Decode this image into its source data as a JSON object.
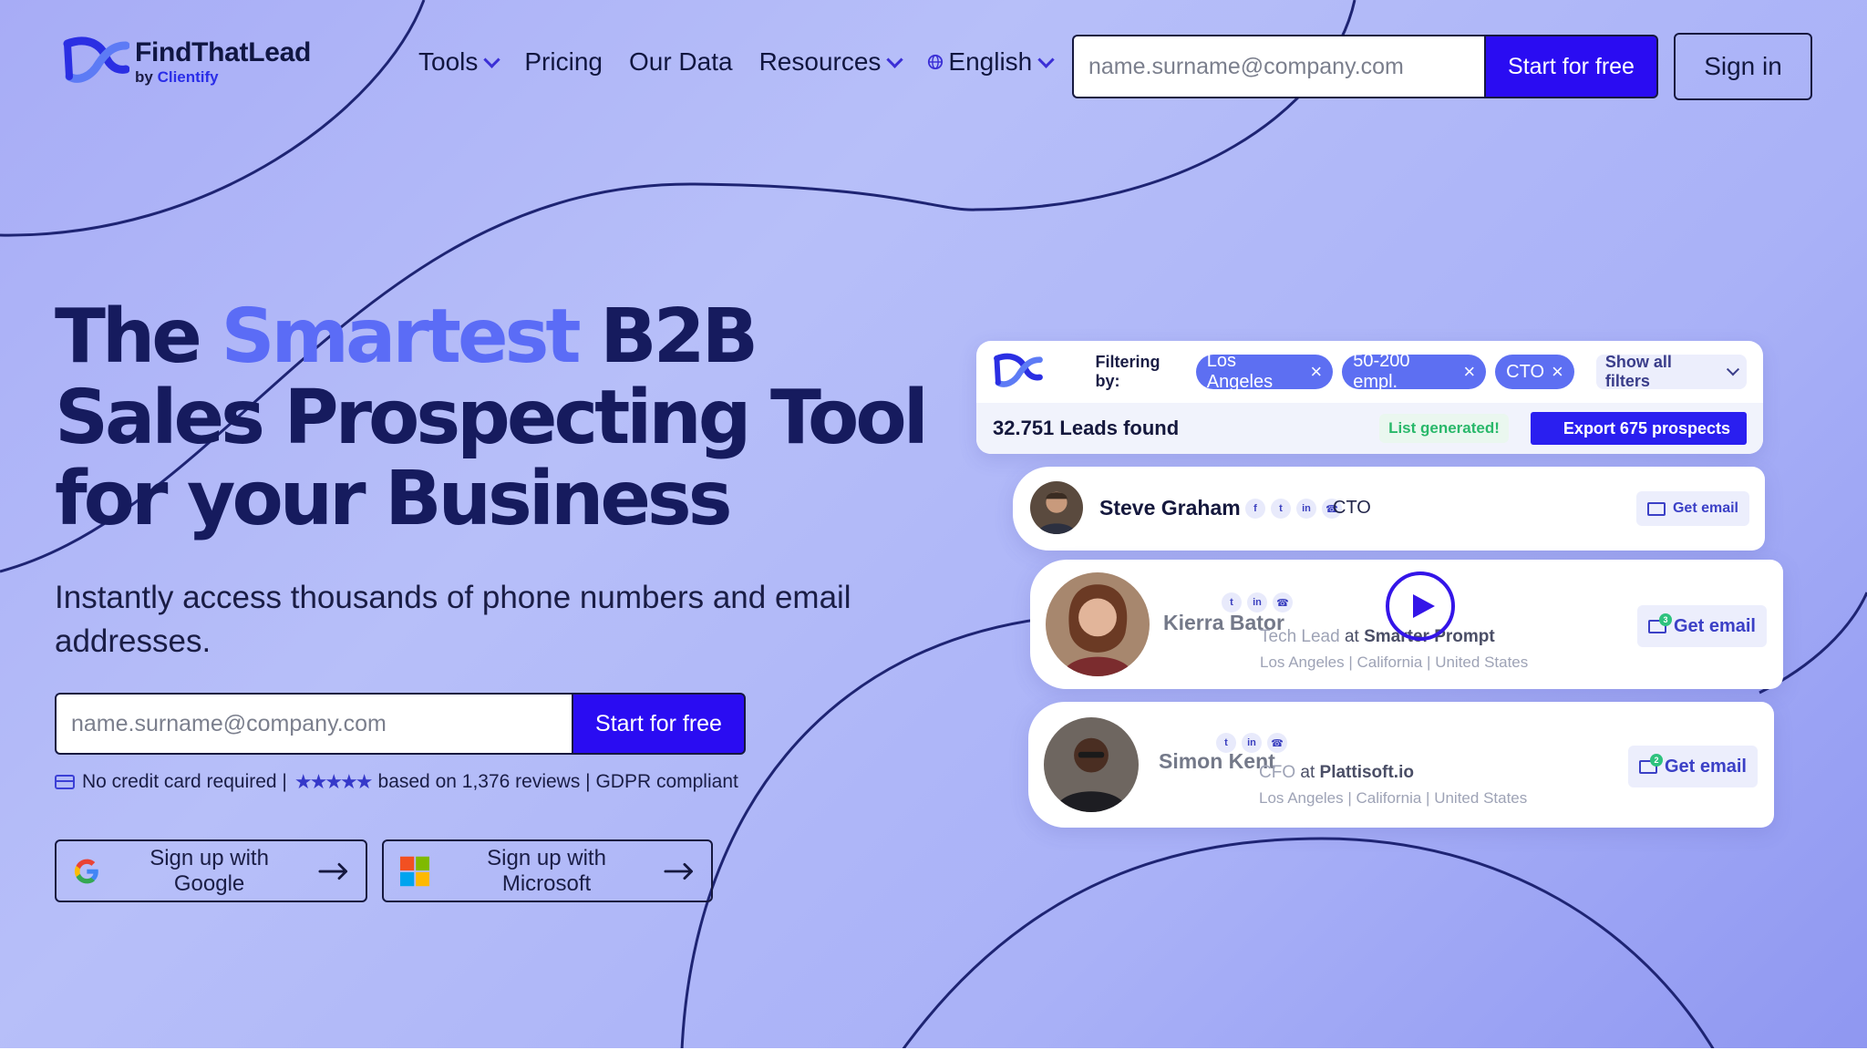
{
  "header": {
    "logo_name": "FindThatLead",
    "logo_by": "by",
    "logo_brand": "Clientify",
    "nav": [
      {
        "label": "Tools",
        "has_dropdown": true
      },
      {
        "label": "Pricing",
        "has_dropdown": false
      },
      {
        "label": "Our Data",
        "has_dropdown": false
      },
      {
        "label": "Resources",
        "has_dropdown": true
      },
      {
        "label": "English",
        "has_dropdown": true,
        "icon": "globe-icon"
      }
    ],
    "email_placeholder": "name.surname@company.com",
    "start_label": "Start for free",
    "signin_label": "Sign in"
  },
  "hero": {
    "headline_pre": "The ",
    "headline_accent": "Smartest",
    "headline_post": " B2B Sales Prospecting Tool for your Business",
    "subheadline": "Instantly access thousands of phone numbers and email addresses.",
    "email_placeholder": "name.surname@company.com",
    "start_label": "Start for free",
    "no_card": "No credit card required |",
    "stars": "★★★★★",
    "reviews": "based on 1,376 reviews | GDPR compliant",
    "google_label": "Sign up with Google",
    "microsoft_label": "Sign up with Microsoft"
  },
  "panel": {
    "filtering_label": "Filtering by:",
    "chips": [
      "Los Angeles",
      "50-200 empl.",
      "CTO"
    ],
    "show_filters": "Show all filters",
    "leads_found": "32.751 Leads found",
    "list_generated": "List generated!",
    "export_label": "Export 675 prospects",
    "leads": [
      {
        "name": "Steve Graham",
        "role": "CTO",
        "get_email": "Get email"
      },
      {
        "name": "Kierra Bator",
        "role": "Tech Lead",
        "at": "at",
        "company": "Smarter Prompt",
        "location": [
          "Los Angeles",
          "California",
          "United States"
        ],
        "get_email": "Get email",
        "badge": "3"
      },
      {
        "name": "Simon Kent",
        "role": "CFO",
        "at": "at",
        "company": "Plattisoft.io",
        "location": [
          "Los Angeles",
          "California",
          "United States"
        ],
        "get_email": "Get email",
        "badge": "2"
      }
    ]
  },
  "colors": {
    "primary": "#2a0cf2",
    "accent": "#5b6cf6",
    "headline": "#161b5e",
    "chip": "#5d6ff2",
    "success": "#29b86a"
  }
}
